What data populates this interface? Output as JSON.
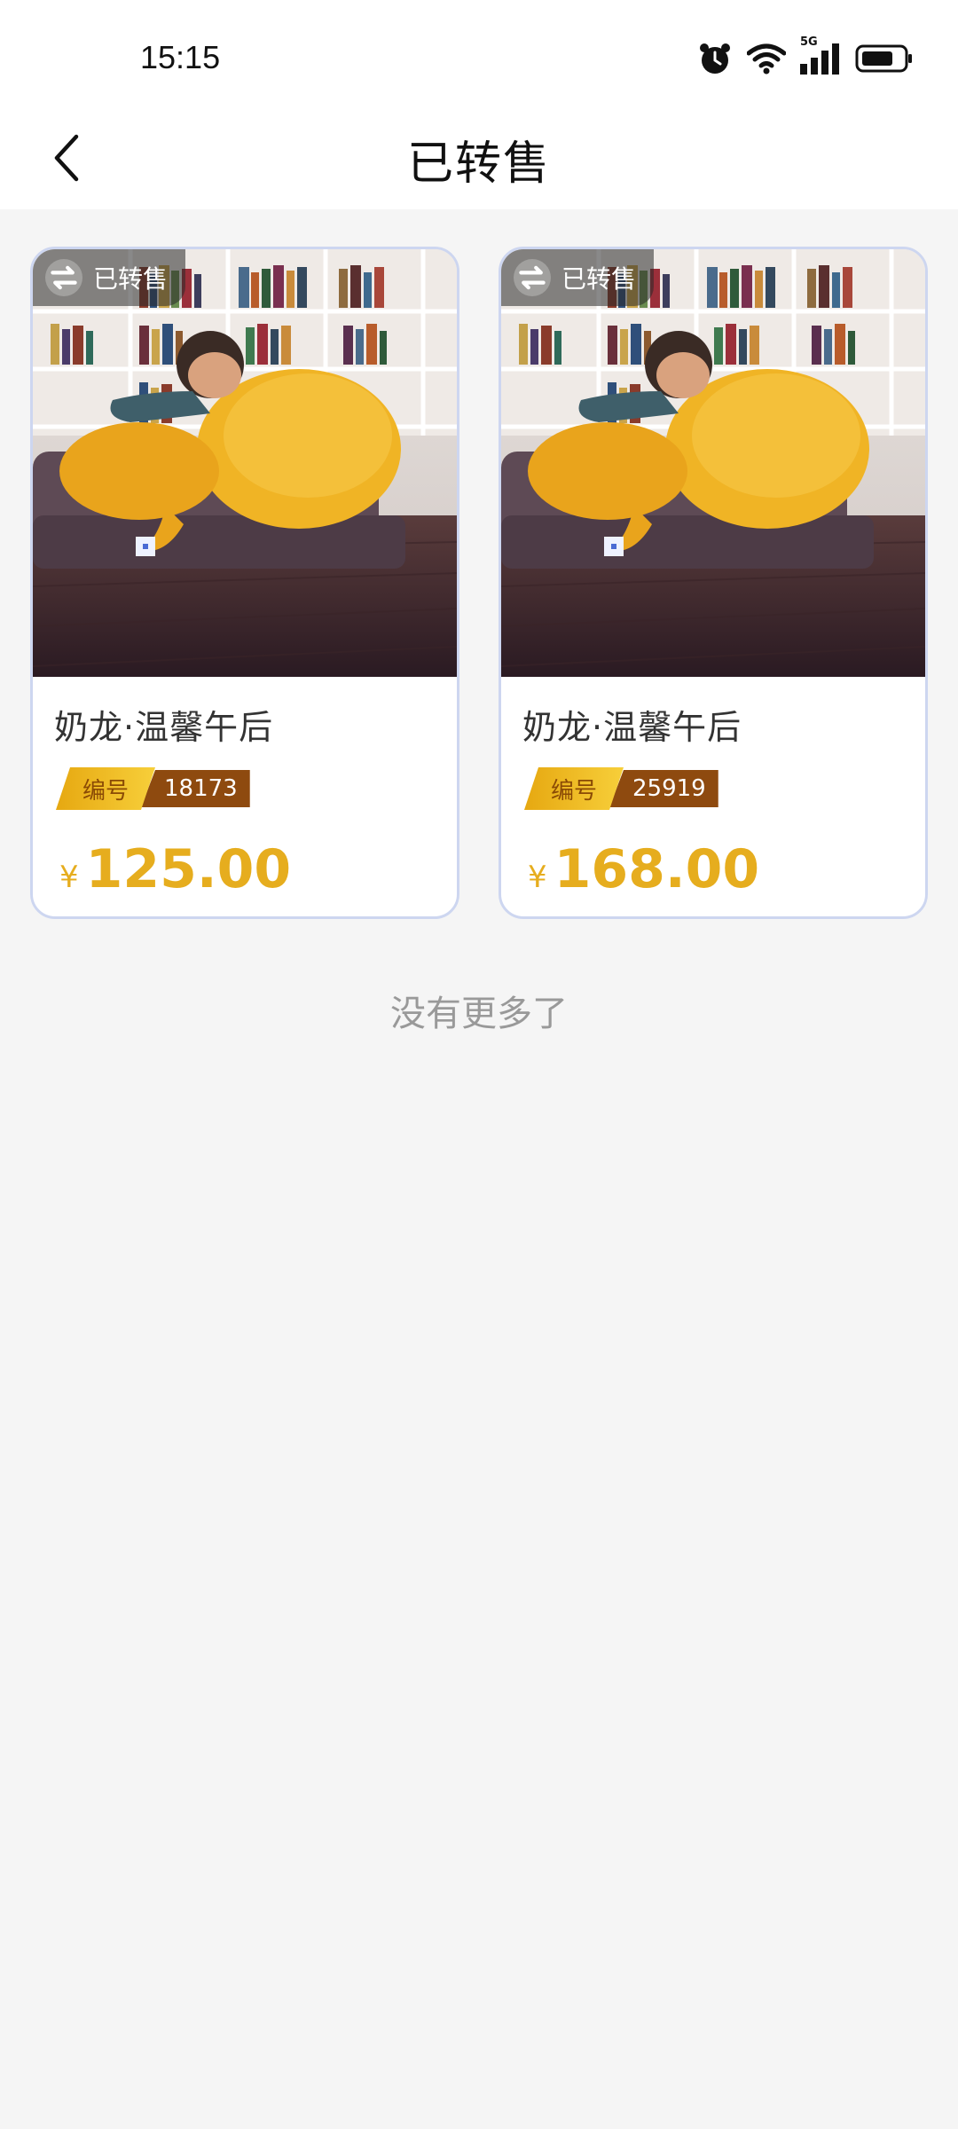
{
  "status_bar": {
    "time": "15:15",
    "icons": [
      "alarm-icon",
      "wifi-icon",
      "5g-signal-icon",
      "battery-icon"
    ],
    "network_label": "5G"
  },
  "nav": {
    "title": "已转售",
    "back_icon": "chevron-left-icon"
  },
  "items": [
    {
      "badge": "已转售",
      "name": "奶龙·温馨午后",
      "serial_label": "编号",
      "serial": "18173",
      "currency": "¥",
      "price": "125.00"
    },
    {
      "badge": "已转售",
      "name": "奶龙·温馨午后",
      "serial_label": "编号",
      "serial": "25919",
      "currency": "¥",
      "price": "168.00"
    }
  ],
  "footer": {
    "no_more": "没有更多了"
  },
  "colors": {
    "accent_gold": "#e6ad1e",
    "serial_brown": "#8e4a0f",
    "card_border": "#cdd6f0",
    "page_bg": "#f5f5f5"
  }
}
